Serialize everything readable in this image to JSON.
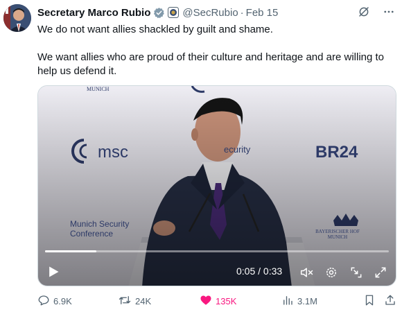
{
  "author": {
    "name": "Secretary Marco Rubio",
    "handle": "@SecRubio",
    "date": "Feb 15"
  },
  "tweet": {
    "paragraphs": [
      "We do not want allies shackled by guilt and shame.",
      "We want allies who are proud of their culture and heritage and are willing to help us defend it."
    ]
  },
  "video": {
    "time": "0:05 / 0:33",
    "progress": 0.15,
    "backdrop": {
      "munich_top": "MUNICH",
      "msc": "msc",
      "security": "ecurity",
      "br24": "BR24",
      "msc_conf_line1": "Munich Security",
      "msc_conf_line2": "Conference",
      "bayerischer_line1": "BAYERISCHER HOF",
      "bayerischer_line2": "MUNICH"
    }
  },
  "actions": {
    "replies": "6.9K",
    "reposts": "24K",
    "likes": "135K",
    "views": "3.1M"
  },
  "colors": {
    "verified_badge": "#829aab",
    "like": "#f91880",
    "secondary_text": "#536471",
    "backdrop_text": "#2d3a67"
  },
  "icons": [
    "verified-badge-icon",
    "state-seal-icon",
    "grok-icon",
    "more-icon",
    "play-icon",
    "mute-icon",
    "settings-icon",
    "minimize-icon",
    "fullscreen-icon",
    "reply-icon",
    "repost-icon",
    "like-icon",
    "views-icon",
    "bookmark-icon",
    "share-icon"
  ]
}
